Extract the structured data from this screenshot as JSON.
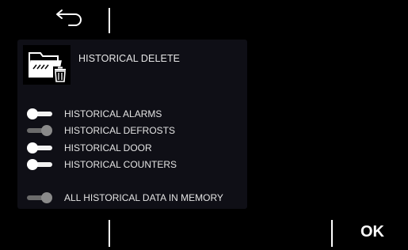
{
  "header": {
    "back_icon": "back-arrow-icon"
  },
  "panel": {
    "icon": "historical-delete-folder-trash-icon",
    "title": "HISTORICAL DELETE",
    "items": [
      {
        "label": "HISTORICAL ALARMS",
        "state": "off"
      },
      {
        "label": "HISTORICAL DEFROSTS",
        "state": "on"
      },
      {
        "label": "HISTORICAL DOOR",
        "state": "off"
      },
      {
        "label": "HISTORICAL COUNTERS",
        "state": "off"
      },
      {
        "label": "ALL HISTORICAL DATA IN MEMORY",
        "state": "on"
      }
    ]
  },
  "footer": {
    "ok_label": "OK"
  }
}
